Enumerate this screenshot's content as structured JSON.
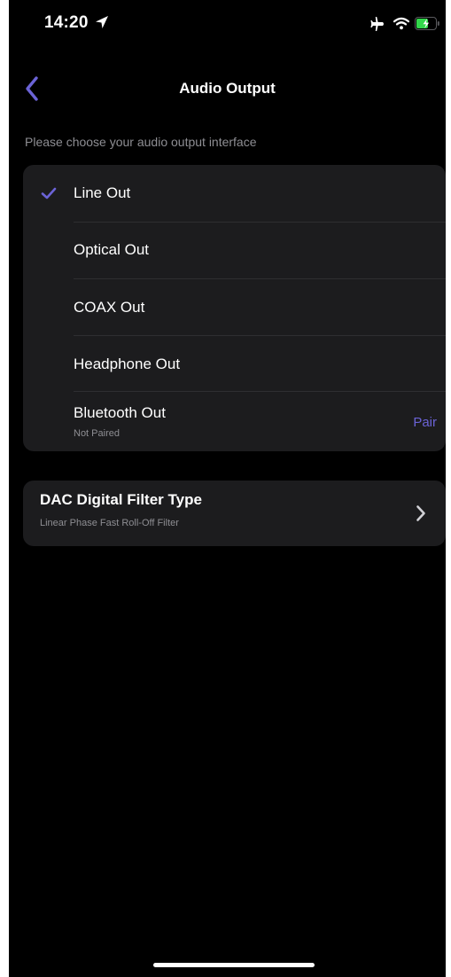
{
  "status_bar": {
    "time": "14:20"
  },
  "nav": {
    "title": "Audio Output"
  },
  "output": {
    "section_label": "Please choose your audio output interface",
    "selected": "Line Out",
    "options": [
      {
        "label": "Line Out"
      },
      {
        "label": "Optical Out"
      },
      {
        "label": "COAX Out"
      },
      {
        "label": "Headphone Out"
      },
      {
        "label": "Bluetooth Out",
        "sublabel": "Not Paired",
        "action": "Pair"
      }
    ]
  },
  "dac_filter": {
    "title": "DAC Digital Filter Type",
    "value": "Linear Phase Fast Roll-Off Filter"
  },
  "colors": {
    "background": "#000000",
    "group_background": "#1c1c1e",
    "accent": "#6b63d6",
    "secondary_text": "#8e8e93"
  },
  "icons": [
    "location-arrow-icon",
    "airplane-icon",
    "wifi-icon",
    "battery-charging-icon",
    "back-chevron-icon",
    "checkmark-icon",
    "chevron-right-icon"
  ]
}
